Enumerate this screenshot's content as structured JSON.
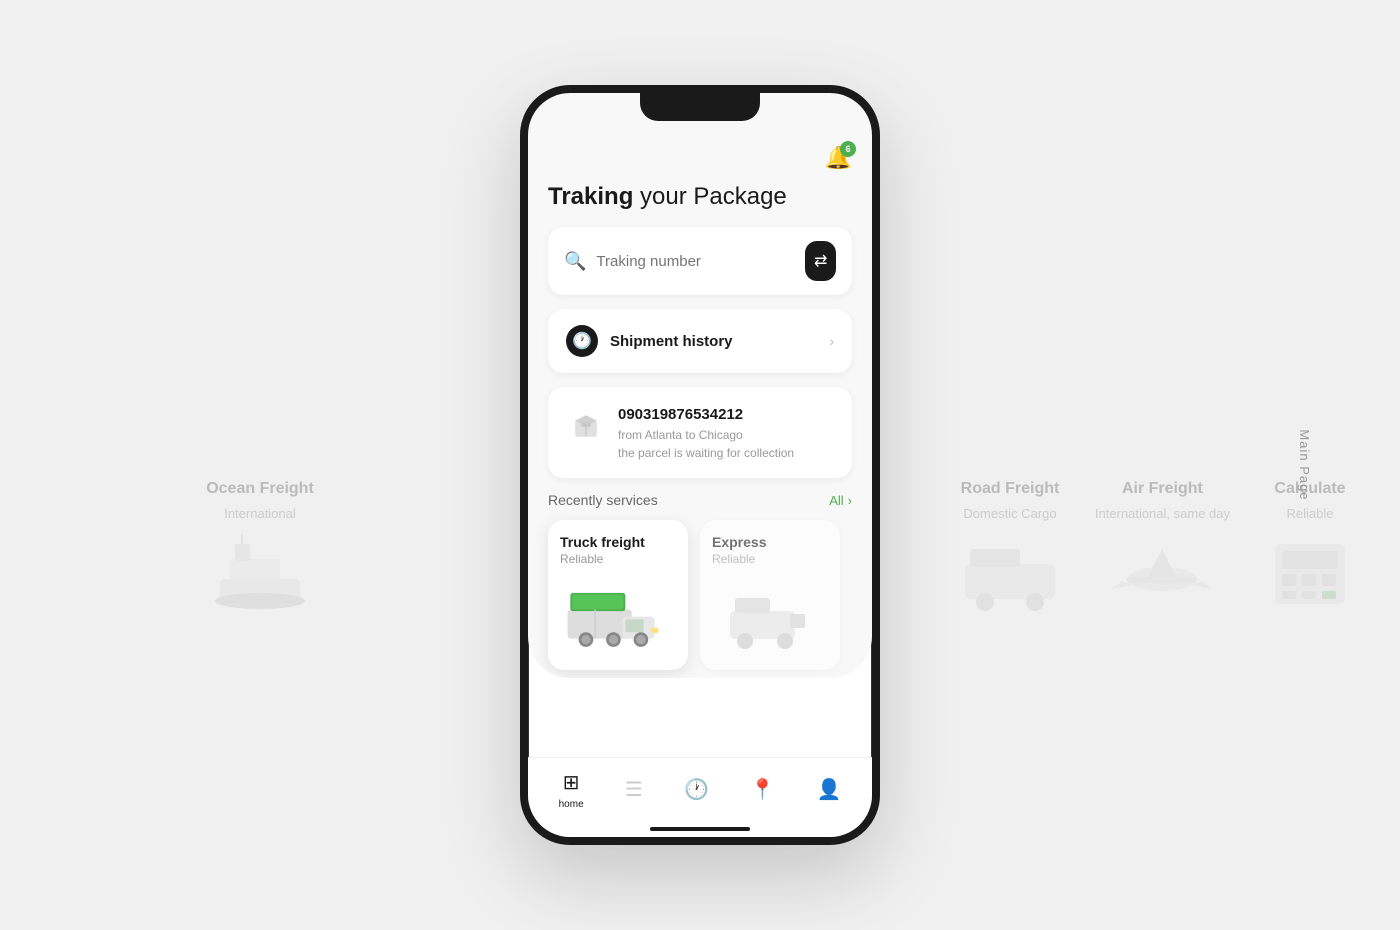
{
  "page": {
    "side_label": "Main Page"
  },
  "header": {
    "title_bold": "Traking",
    "title_rest": " your Package",
    "bell_badge": "6"
  },
  "search": {
    "placeholder": "Traking number"
  },
  "shipment": {
    "section_title": "Shipment history"
  },
  "tracking": {
    "number": "090319876534212",
    "route": "from Atlanta to Chicago",
    "status": "the parcel is waiting for collection"
  },
  "services": {
    "section_title": "Recently services",
    "all_label": "All",
    "items": [
      {
        "name": "Truck freight",
        "subtitle": "Reliable",
        "active": true
      },
      {
        "name": "Express",
        "subtitle": "Reliable",
        "active": false
      },
      {
        "name": "Road Freight",
        "subtitle": "Domestic Cargo",
        "active": false
      },
      {
        "name": "Air Freight",
        "subtitle": "International, same day",
        "active": false
      },
      {
        "name": "Calculate",
        "subtitle": "Reliable",
        "active": false
      }
    ]
  },
  "bg_services": [
    {
      "name": "Ocean Freight",
      "subtitle": "International"
    },
    {
      "name": "Express",
      "subtitle": "Reliable"
    },
    {
      "name": "Road Freight",
      "subtitle": "Domestic Cargo"
    },
    {
      "name": "Air Freight",
      "subtitle": "International, same day"
    },
    {
      "name": "Calculate",
      "subtitle": "Reliable"
    }
  ],
  "nav": {
    "items": [
      {
        "icon": "🏠",
        "label": "home",
        "active": true
      },
      {
        "icon": "☰",
        "label": "",
        "active": false
      },
      {
        "icon": "🕐",
        "label": "",
        "active": false
      },
      {
        "icon": "📍",
        "label": "",
        "active": false
      },
      {
        "icon": "👤",
        "label": "",
        "active": false
      }
    ]
  }
}
